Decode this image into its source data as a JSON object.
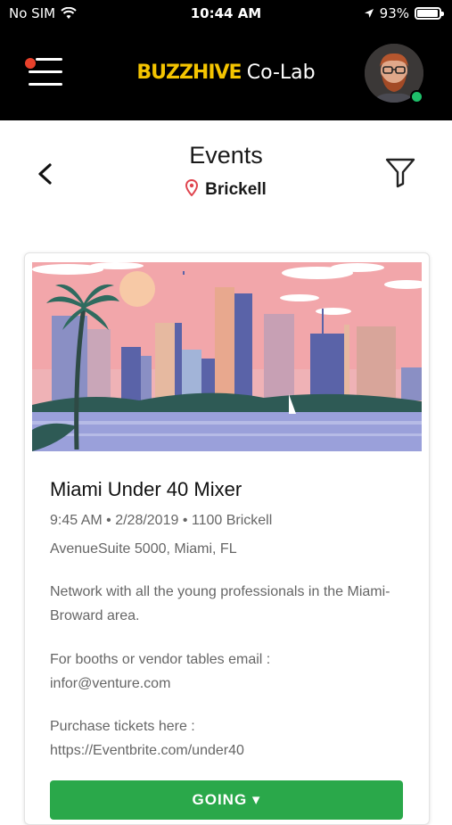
{
  "status_bar": {
    "carrier": "No SIM",
    "time": "10:44 AM",
    "battery": "93%",
    "battery_level": 0.93
  },
  "navbar": {
    "brand_part1": "BUZZHIVE",
    "brand_part2": "Co-Lab",
    "brand_color": "#f4c400",
    "notification_color": "#e8412b",
    "online_color": "#1ec06a"
  },
  "header": {
    "title": "Events",
    "location": "Brickell"
  },
  "event": {
    "title": "Miami Under 40 Mixer",
    "meta_line1": "9:45 AM • 2/28/2019 • 1100 Brickell",
    "meta_line2": "AvenueSuite 5000, Miami, FL",
    "description": "Network with all the young professionals in the Miami-Broward area.",
    "email_label": "For booths or vendor tables email :",
    "email": "infor@venture.com",
    "tickets_label": "Purchase tickets here :",
    "tickets_url": "https://Eventbrite.com/under40",
    "button_label": "GOING",
    "button_color": "#2aa84a"
  }
}
